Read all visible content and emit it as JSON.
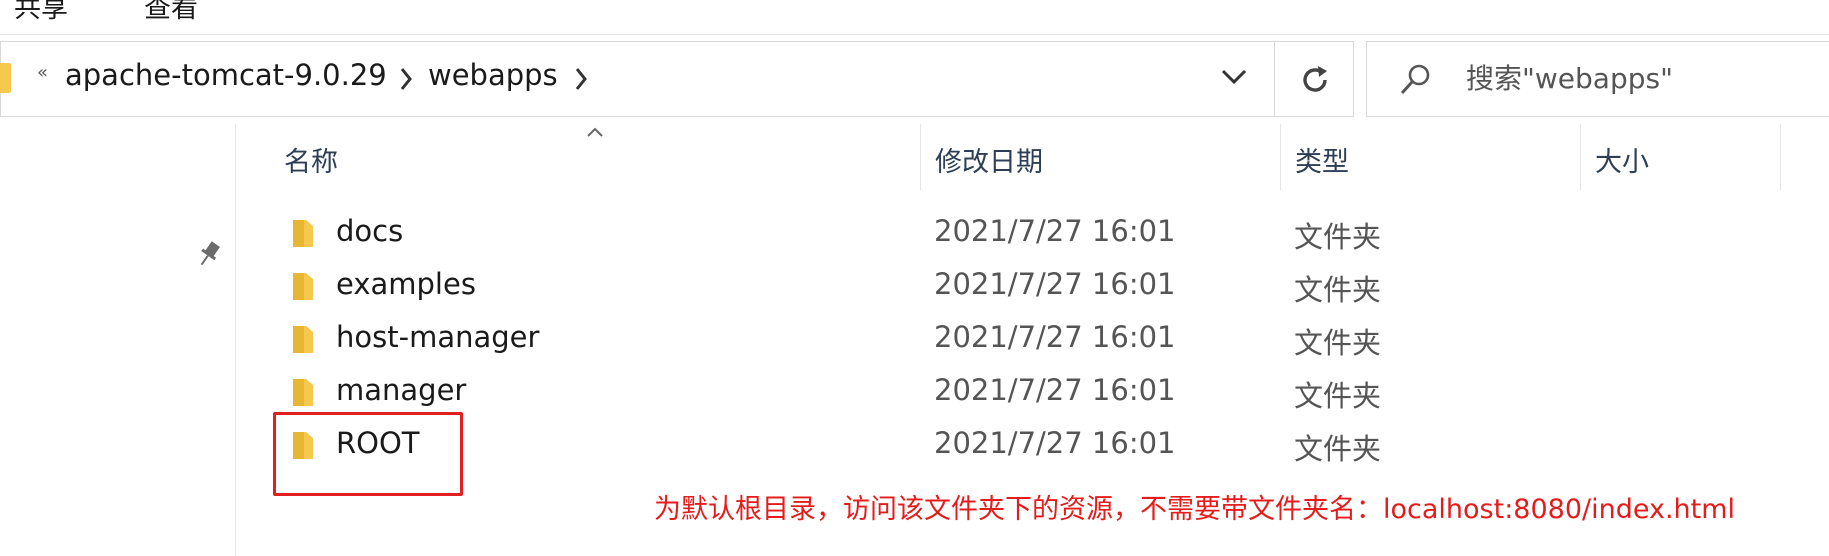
{
  "ribbon": {
    "tabs": [
      "共享",
      "查看"
    ]
  },
  "address_bar": {
    "crumbs": [
      "apache-tomcat-9.0.29",
      "webapps"
    ]
  },
  "search": {
    "placeholder": "搜索\"webapps\""
  },
  "columns": {
    "name": "名称",
    "date": "修改日期",
    "type": "类型",
    "size": "大小"
  },
  "files": [
    {
      "name": "docs",
      "date": "2021/7/27 16:01",
      "type": "文件夹"
    },
    {
      "name": "examples",
      "date": "2021/7/27 16:01",
      "type": "文件夹"
    },
    {
      "name": "host-manager",
      "date": "2021/7/27 16:01",
      "type": "文件夹"
    },
    {
      "name": "manager",
      "date": "2021/7/27 16:01",
      "type": "文件夹"
    },
    {
      "name": "ROOT",
      "date": "2021/7/27 16:01",
      "type": "文件夹"
    }
  ],
  "annotation": "为默认根目录，访问该文件夹下的资源，不需要带文件夹名：localhost:8080/index.html",
  "colors": {
    "folder": "#f6c94e",
    "highlight": "#e02020",
    "annotation_text": "#e51c1c",
    "header_text": "#2e3f55"
  }
}
